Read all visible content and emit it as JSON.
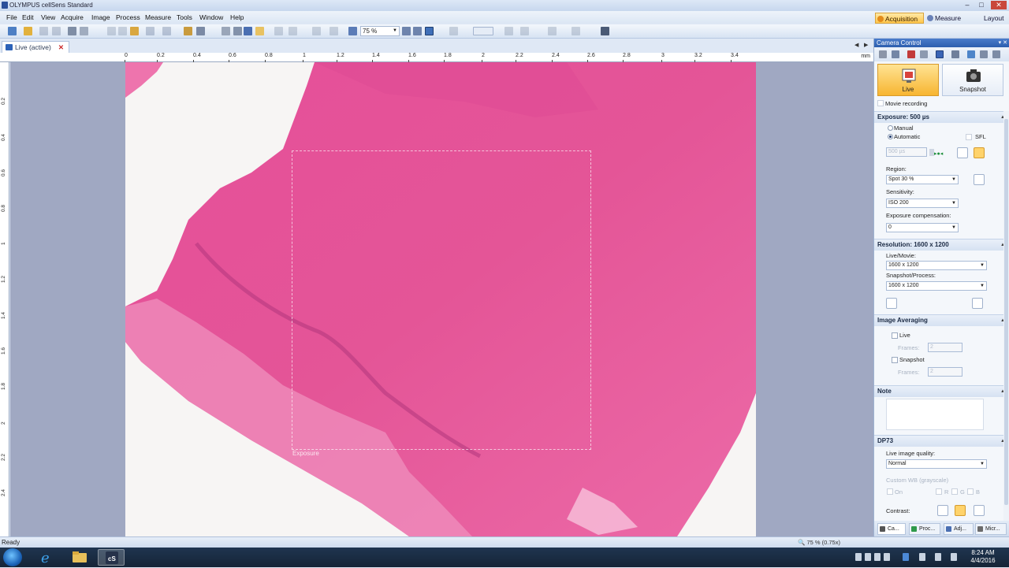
{
  "window": {
    "title": "OLYMPUS cellSens Standard"
  },
  "menu": [
    "File",
    "Edit",
    "View",
    "Acquire",
    "Image",
    "Process",
    "Measure",
    "Tools",
    "Window",
    "Help"
  ],
  "modes": {
    "acquisition": "Acquisition",
    "measure": "Measure",
    "layout": "Layout"
  },
  "toolbar": {
    "zoom_value": "75 %"
  },
  "document": {
    "tab_label": "Live (active)"
  },
  "ruler": {
    "unit": "mm",
    "h_ticks": [
      "0",
      "0.2",
      "0.4",
      "0.6",
      "0.8",
      "1",
      "1.2",
      "1.4",
      "1.6",
      "1.8",
      "2",
      "2.2",
      "2.4",
      "2.6",
      "2.8",
      "3",
      "3.2",
      "3.4"
    ],
    "v_ticks": [
      "0.2",
      "0.4",
      "0.6",
      "0.8",
      "1",
      "1.2",
      "1.4",
      "1.6",
      "1.8",
      "2",
      "2.2",
      "2.4"
    ]
  },
  "canvas": {
    "roi_label": "Exposure"
  },
  "status": {
    "text": "Ready",
    "zoom": "75 % (0.75x)"
  },
  "camera_control": {
    "title": "Camera Control",
    "live_label": "Live",
    "snapshot_label": "Snapshot",
    "movie_recording": "Movie recording",
    "exposure": {
      "header": "Exposure: 500 µs",
      "manual": "Manual",
      "automatic": "Automatic",
      "sfl": "SFL",
      "value": "500 µs",
      "region_label": "Region:",
      "region_value": "Spot 30 %",
      "sensitivity_label": "Sensitivity:",
      "sensitivity_value": "ISO 200",
      "compensation_label": "Exposure compensation:",
      "compensation_value": "0"
    },
    "resolution": {
      "header": "Resolution: 1600 x 1200",
      "live_movie_label": "Live/Movie:",
      "live_movie_value": "1600 x 1200",
      "snapshot_label": "Snapshot/Process:",
      "snapshot_value": "1600 x 1200"
    },
    "averaging": {
      "header": "Image Averaging",
      "live": "Live",
      "live_frames_label": "Frames:",
      "live_frames": "2",
      "snapshot": "Snapshot",
      "snapshot_frames_label": "Frames:",
      "snapshot_frames": "2"
    },
    "note": {
      "header": "Note"
    },
    "dp73": {
      "header": "DP73",
      "quality_label": "Live image quality:",
      "quality_value": "Normal",
      "custom_wb": "Custom WB (grayscale)",
      "on": "On",
      "r": "R",
      "g": "G",
      "b": "B",
      "contrast_label": "Contrast:"
    },
    "bottom_tabs": [
      "Ca...",
      "Proc...",
      "Adj...",
      "Micr..."
    ]
  },
  "taskbar": {
    "time": "8:24 AM",
    "date": "4/4/2016"
  },
  "colors": {
    "accent": "#f7b531",
    "title_bar": "#2c5eae",
    "tissue": "#e8559a"
  }
}
